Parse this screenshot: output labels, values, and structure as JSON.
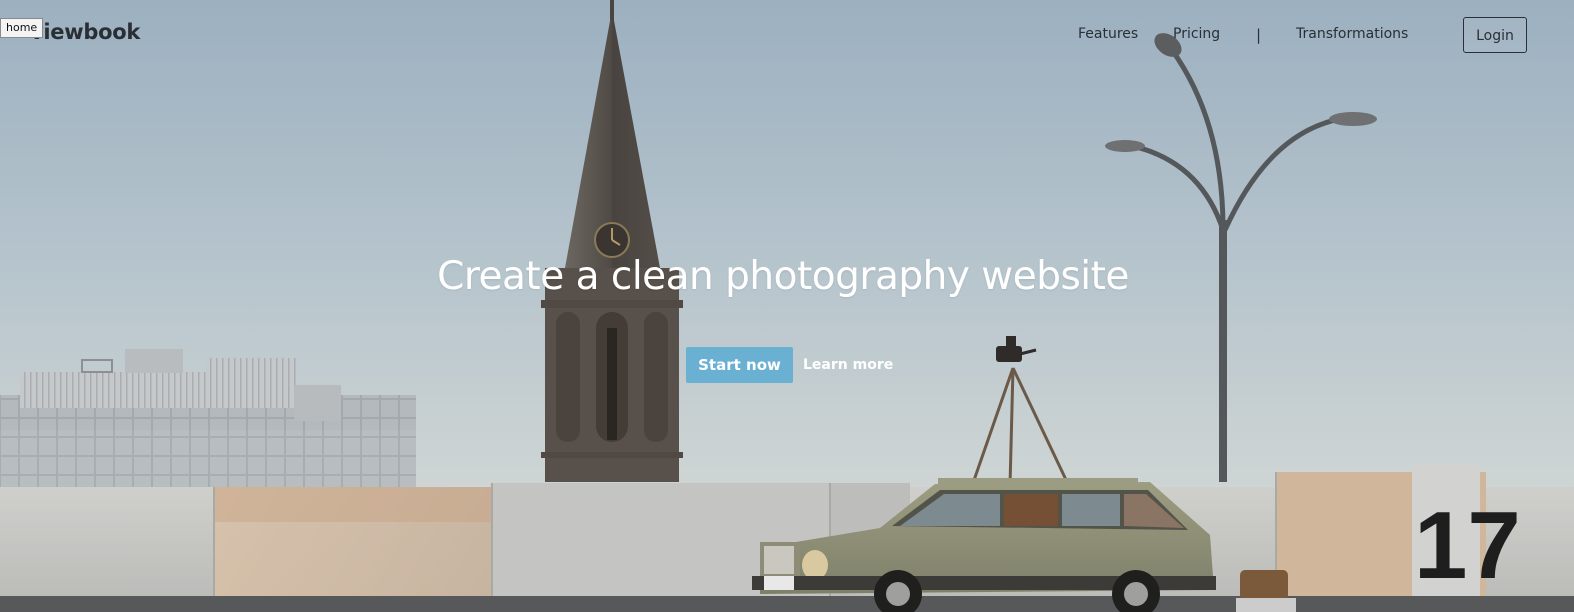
{
  "tooltip": "home",
  "header": {
    "logo": "viewbook",
    "nav": [
      "Features",
      "Pricing",
      "|",
      "Transformations"
    ],
    "login_label": "Login"
  },
  "hero": {
    "headline": "Create a clean photography website",
    "start_label": "Start now",
    "learn_label": "Learn more",
    "wall_number": "17",
    "colors": {
      "accent": "#6ab0d2",
      "sky_top": "#9fb3c3",
      "sky_bottom": "#d8dddd"
    }
  }
}
